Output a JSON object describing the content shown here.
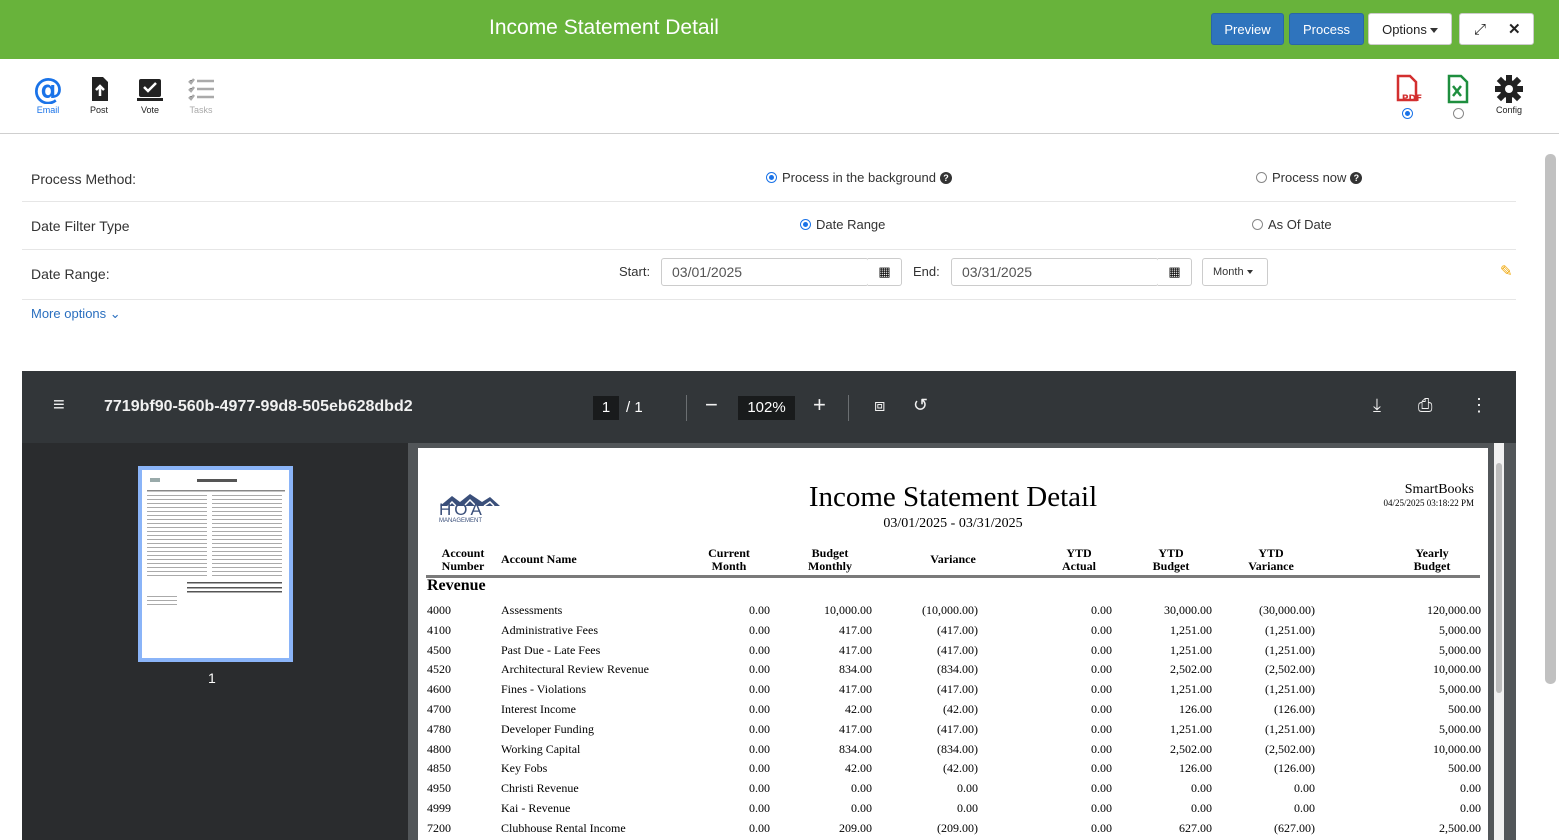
{
  "header": {
    "title": "Income Statement Detail",
    "preview_label": "Preview",
    "process_label": "Process",
    "options_label": "Options"
  },
  "toolbar": {
    "tools": [
      {
        "label": "Email",
        "icon": "at-icon"
      },
      {
        "label": "Post",
        "icon": "post-icon"
      },
      {
        "label": "Vote",
        "icon": "vote-icon"
      },
      {
        "label": "Tasks",
        "icon": "tasks-icon"
      }
    ],
    "config_label": "Config",
    "pdf_label": "PDF",
    "output_selected": "pdf"
  },
  "form": {
    "process_method_label": "Process Method:",
    "process_background_label": "Process in the background",
    "process_now_label": "Process now",
    "date_filter_label": "Date Filter Type",
    "date_range_option": "Date Range",
    "as_of_date_option": "As Of Date",
    "date_range_label": "Date Range:",
    "start_label": "Start:",
    "start_value": "03/01/2025",
    "end_label": "End:",
    "end_value": "03/31/2025",
    "period_label": "Month",
    "more_options_label": "More options"
  },
  "viewer": {
    "filename": "7719bf90-560b-4977-99d8-505eb628dbd2",
    "page_current": "1",
    "page_total": "/ 1",
    "zoom": "102%",
    "thumbnail_label": "1"
  },
  "report": {
    "title": "Income Statement Detail",
    "date_range": "03/01/2025 - 03/31/2025",
    "company": "SmartBooks",
    "timestamp": "04/25/2025 03:18:22 PM",
    "logo_text": "HOA",
    "logo_subtext": "MANAGEMENT",
    "columns": {
      "acct1": "Account",
      "acct2": "Number",
      "name": "Account Name",
      "cm1": "Current",
      "cm2": "Month",
      "bm1": "Budget",
      "bm2": "Monthly",
      "var": "Variance",
      "ya1": "YTD",
      "ya2": "Actual",
      "yb1": "YTD",
      "yb2": "Budget",
      "yv1": "YTD",
      "yv2": "Variance",
      "yr1": "Yearly",
      "yr2": "Budget"
    },
    "section": "Revenue",
    "rows": [
      {
        "num": "4000",
        "name": "Assessments",
        "cur": "0.00",
        "bud": "10,000.00",
        "var": "(10,000.00)",
        "ytda": "0.00",
        "ytdb": "30,000.00",
        "ytdv": "(30,000.00)",
        "year": "120,000.00"
      },
      {
        "num": "4100",
        "name": "Administrative Fees",
        "cur": "0.00",
        "bud": "417.00",
        "var": "(417.00)",
        "ytda": "0.00",
        "ytdb": "1,251.00",
        "ytdv": "(1,251.00)",
        "year": "5,000.00"
      },
      {
        "num": "4500",
        "name": "Past Due - Late Fees",
        "cur": "0.00",
        "bud": "417.00",
        "var": "(417.00)",
        "ytda": "0.00",
        "ytdb": "1,251.00",
        "ytdv": "(1,251.00)",
        "year": "5,000.00"
      },
      {
        "num": "4520",
        "name": "Architectural Review Revenue",
        "cur": "0.00",
        "bud": "834.00",
        "var": "(834.00)",
        "ytda": "0.00",
        "ytdb": "2,502.00",
        "ytdv": "(2,502.00)",
        "year": "10,000.00"
      },
      {
        "num": "4600",
        "name": "Fines - Violations",
        "cur": "0.00",
        "bud": "417.00",
        "var": "(417.00)",
        "ytda": "0.00",
        "ytdb": "1,251.00",
        "ytdv": "(1,251.00)",
        "year": "5,000.00"
      },
      {
        "num": "4700",
        "name": "Interest Income",
        "cur": "0.00",
        "bud": "42.00",
        "var": "(42.00)",
        "ytda": "0.00",
        "ytdb": "126.00",
        "ytdv": "(126.00)",
        "year": "500.00"
      },
      {
        "num": "4780",
        "name": "Developer Funding",
        "cur": "0.00",
        "bud": "417.00",
        "var": "(417.00)",
        "ytda": "0.00",
        "ytdb": "1,251.00",
        "ytdv": "(1,251.00)",
        "year": "5,000.00"
      },
      {
        "num": "4800",
        "name": "Working Capital",
        "cur": "0.00",
        "bud": "834.00",
        "var": "(834.00)",
        "ytda": "0.00",
        "ytdb": "2,502.00",
        "ytdv": "(2,502.00)",
        "year": "10,000.00"
      },
      {
        "num": "4850",
        "name": "Key Fobs",
        "cur": "0.00",
        "bud": "42.00",
        "var": "(42.00)",
        "ytda": "0.00",
        "ytdb": "126.00",
        "ytdv": "(126.00)",
        "year": "500.00"
      },
      {
        "num": "4950",
        "name": "Christi Revenue",
        "cur": "0.00",
        "bud": "0.00",
        "var": "0.00",
        "ytda": "0.00",
        "ytdb": "0.00",
        "ytdv": "0.00",
        "year": "0.00"
      },
      {
        "num": "4999",
        "name": "Kai - Revenue",
        "cur": "0.00",
        "bud": "0.00",
        "var": "0.00",
        "ytda": "0.00",
        "ytdb": "0.00",
        "ytdv": "0.00",
        "year": "0.00"
      },
      {
        "num": "7200",
        "name": "Clubhouse Rental Income",
        "cur": "0.00",
        "bud": "209.00",
        "var": "(209.00)",
        "ytda": "0.00",
        "ytdb": "627.00",
        "ytdv": "(627.00)",
        "year": "2,500.00"
      }
    ]
  }
}
